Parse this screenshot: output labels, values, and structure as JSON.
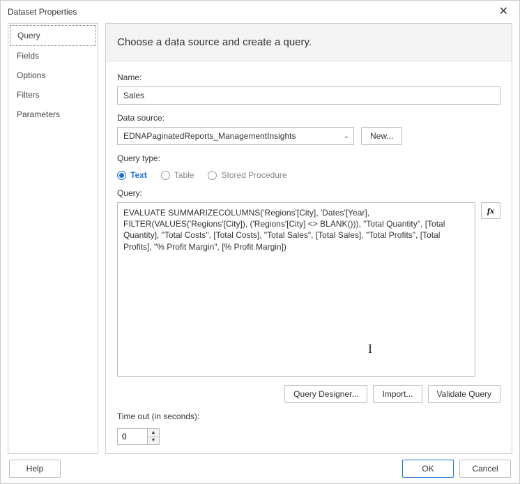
{
  "window": {
    "title": "Dataset Properties"
  },
  "sidebar": {
    "items": [
      {
        "label": "Query",
        "selected": true
      },
      {
        "label": "Fields",
        "selected": false
      },
      {
        "label": "Options",
        "selected": false
      },
      {
        "label": "Filters",
        "selected": false
      },
      {
        "label": "Parameters",
        "selected": false
      }
    ]
  },
  "main": {
    "heading": "Choose a data source and create a query.",
    "name_label": "Name:",
    "name_value": "Sales",
    "datasource_label": "Data source:",
    "datasource_value": "EDNAPaginatedReports_ManagementInsights",
    "new_btn": "New...",
    "querytype_label": "Query type:",
    "querytypes": {
      "text": "Text",
      "table": "Table",
      "stored": "Stored Procedure"
    },
    "query_label": "Query:",
    "query_text": "EVALUATE SUMMARIZECOLUMNS('Regions'[City], 'Dates'[Year], FILTER(VALUES('Regions'[City]), ('Regions'[City] <> BLANK())), \"Total Quantity\", [Total Quantity], \"Total Costs\", [Total Costs], \"Total Sales\", [Total Sales], \"Total Profits\", [Total Profits], \"% Profit Margin\", [% Profit Margin])",
    "fx_label": "fx",
    "query_designer_btn": "Query Designer...",
    "import_btn": "Import...",
    "validate_btn": "Validate Query",
    "timeout_label": "Time out (in seconds):",
    "timeout_value": "0"
  },
  "footer": {
    "help": "Help",
    "ok": "OK",
    "cancel": "Cancel"
  }
}
